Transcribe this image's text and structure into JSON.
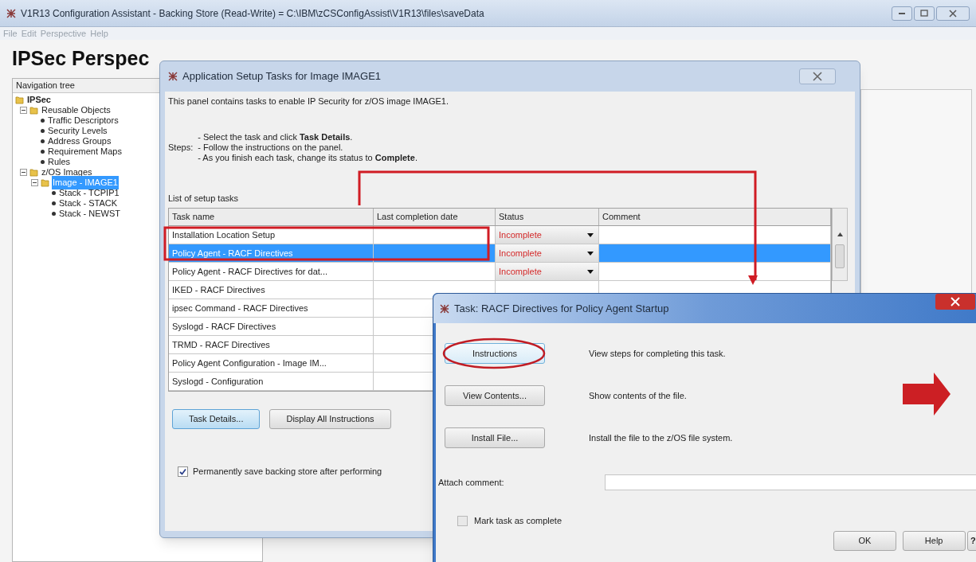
{
  "window": {
    "title": "V1R13 Configuration Assistant - Backing Store (Read-Write) = C:\\IBM\\zCSConfigAssist\\V1R13\\files\\saveData",
    "menu": [
      {
        "label": "File",
        "disabled": true
      },
      {
        "label": "Edit",
        "disabled": true
      },
      {
        "label": "Perspective",
        "disabled": true
      },
      {
        "label": "Help",
        "disabled": true
      }
    ]
  },
  "perspective_title": "IPSec Perspec",
  "navigation_tree": {
    "header": "Navigation tree",
    "items": [
      {
        "label": "IPSec",
        "kind": "folder",
        "selected": false,
        "children": [
          {
            "label": "Reusable Objects",
            "kind": "folder",
            "expanded": true,
            "selected": false,
            "children": [
              {
                "label": "Traffic Descriptors",
                "kind": "leaf",
                "selected": false
              },
              {
                "label": "Security Levels",
                "kind": "leaf",
                "selected": false
              },
              {
                "label": "Address Groups",
                "kind": "leaf",
                "selected": false
              },
              {
                "label": "Requirement Maps",
                "kind": "leaf",
                "selected": false
              },
              {
                "label": "Rules",
                "kind": "leaf",
                "selected": false
              }
            ]
          },
          {
            "label": "z/OS Images",
            "kind": "folder",
            "expanded": true,
            "selected": false,
            "children": [
              {
                "label": "Image - IMAGE1",
                "kind": "folder",
                "expanded": true,
                "selected": true,
                "children": [
                  {
                    "label": "Stack - TCPIP1",
                    "kind": "leaf",
                    "selected": false
                  },
                  {
                    "label": "Stack - STACK",
                    "kind": "leaf",
                    "selected": false
                  },
                  {
                    "label": "Stack - NEWST",
                    "kind": "leaf",
                    "selected": false
                  }
                ]
              }
            ]
          }
        ]
      }
    ]
  },
  "setup_dialog": {
    "title": "Application Setup Tasks for Image IMAGE1",
    "intro": "This panel contains tasks to enable IP Security for z/OS image IMAGE1.",
    "steps_label": "Steps:",
    "steps": [
      "- Select the task and click **Task Details**.",
      "- Follow the instructions on the panel.",
      "- As you finish each task, change its status to **Complete**."
    ],
    "list_label": "List of setup tasks",
    "columns": [
      "Task name",
      "Last completion date",
      "Status",
      "Comment"
    ],
    "rows": [
      {
        "task": "Installation Location Setup",
        "status": "Incomplete",
        "selected": false
      },
      {
        "task": "Policy Agent - RACF Directives",
        "status": "Incomplete",
        "selected": true
      },
      {
        "task": "Policy Agent - RACF Directives for dat...",
        "status": "Incomplete",
        "selected": false
      },
      {
        "task": "IKED - RACF Directives",
        "selected": false
      },
      {
        "task": "ipsec Command - RACF Directives",
        "selected": false
      },
      {
        "task": "Syslogd - RACF Directives",
        "selected": false
      },
      {
        "task": "TRMD - RACF Directives",
        "selected": false
      },
      {
        "task": "Policy Agent Configuration - Image IM...",
        "selected": false
      },
      {
        "task": "Syslogd - Configuration",
        "selected": false
      }
    ],
    "buttons": [
      {
        "label": "Task Details...",
        "focused": true
      },
      {
        "label": "Display All Instructions",
        "focused": false
      }
    ],
    "save_option": {
      "label": "Permanently save backing store after performing",
      "checked": true
    }
  },
  "task_dialog": {
    "title": "Task: RACF Directives for Policy Agent Startup",
    "actions": [
      {
        "button": "Instructions",
        "description": "View steps for completing this task."
      },
      {
        "button": "View Contents...",
        "description": "Show contents of the file."
      },
      {
        "button": "Install File...",
        "description": "Install the file to the z/OS file system."
      }
    ],
    "comment_label": "Attach comment:",
    "complete_option": {
      "label": "Mark task as complete",
      "checked": false
    },
    "buttons": [
      "OK",
      "Help",
      "?"
    ]
  }
}
